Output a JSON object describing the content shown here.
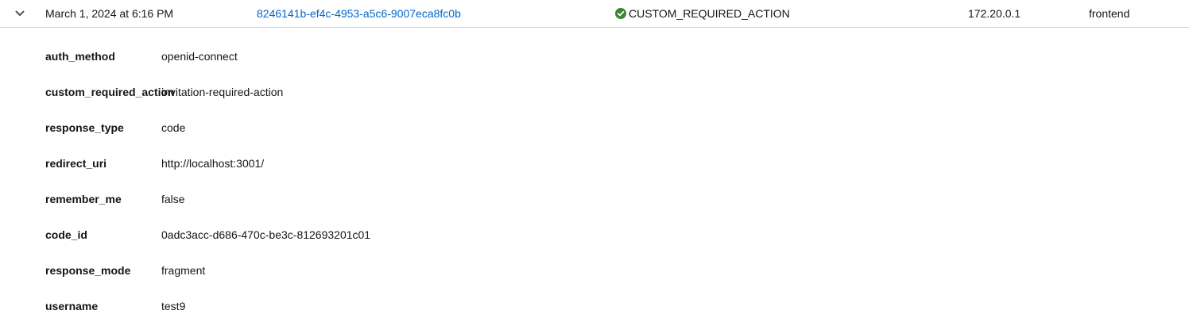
{
  "event_row": {
    "expanded": true,
    "time": "March 1, 2024 at 6:16 PM",
    "user_id": "8246141b-ef4c-4953-a5c6-9007eca8fc0b",
    "event_type": "CUSTOM_REQUIRED_ACTION",
    "event_type_status_icon": "check-circle-icon",
    "ip_address": "172.20.0.1",
    "client": "frontend",
    "toggle_icon": "chevron-down-icon"
  },
  "details": [
    {
      "key": "auth_method",
      "value": "openid-connect"
    },
    {
      "key": "custom_required_action",
      "value": "invitation-required-action"
    },
    {
      "key": "response_type",
      "value": "code"
    },
    {
      "key": "redirect_uri",
      "value": "http://localhost:3001/"
    },
    {
      "key": "remember_me",
      "value": "false"
    },
    {
      "key": "code_id",
      "value": "0adc3acc-d686-470c-be3c-812693201c01"
    },
    {
      "key": "response_mode",
      "value": "fragment"
    },
    {
      "key": "username",
      "value": "test9"
    }
  ],
  "colors": {
    "link": "#0066cc",
    "success": "#3e8635",
    "text": "#151515",
    "border": "#d2d2d2"
  }
}
